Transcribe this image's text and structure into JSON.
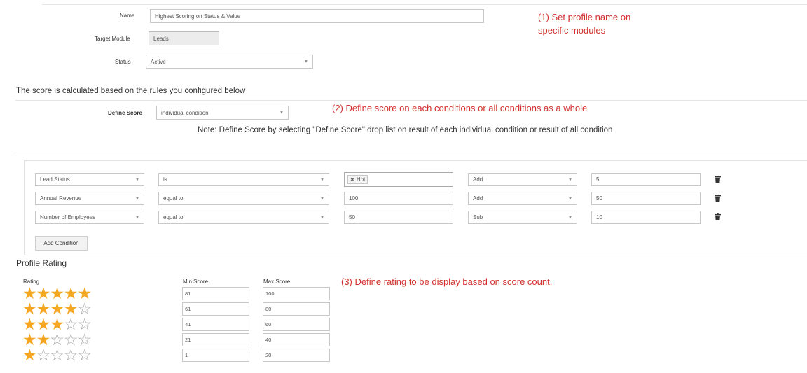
{
  "profile": {
    "name_label": "Name",
    "name_value": "Highest Scoring on Status & Value",
    "module_label": "Target Module",
    "module_value": "Leads",
    "status_label": "Status",
    "status_value": "Active"
  },
  "annotations": {
    "one_line1": "(1) Set profile name  on",
    "one_line2": "specific modules",
    "two": "(2) Define score on each conditions or all conditions as a whole",
    "three": "(3) Define rating to be display based on score count."
  },
  "score_section": {
    "heading": "The score is calculated based on the rules you configured below",
    "define_label": "Define Score",
    "define_value": "individual condition",
    "note": "Note: Define Score by selecting \"Define Score\" drop list on result of each individual condition or result of all condition"
  },
  "conditions": [
    {
      "field": "Lead Status",
      "operator": "is",
      "value": "Hot",
      "action": "Add",
      "points": "5"
    },
    {
      "field": "Annual Revenue",
      "operator": "equal to",
      "value": "100",
      "action": "Add",
      "points": "50"
    },
    {
      "field": "Number of Employees",
      "operator": "equal to",
      "value": "50",
      "action": "Sub",
      "points": "10"
    }
  ],
  "add_condition_label": "Add Condition",
  "rating": {
    "heading": "Profile Rating",
    "col_rating": "Rating",
    "col_min": "Min Score",
    "col_max": "Max Score",
    "rows": [
      {
        "stars": 5,
        "min": "81",
        "max": "100"
      },
      {
        "stars": 4,
        "min": "61",
        "max": "80"
      },
      {
        "stars": 3,
        "min": "41",
        "max": "60"
      },
      {
        "stars": 2,
        "min": "21",
        "max": "40"
      },
      {
        "stars": 1,
        "min": "1",
        "max": "20"
      }
    ]
  },
  "colors": {
    "annotation": "#d32f2f",
    "star_on": "#f5a623",
    "star_off": "#a8a8a8"
  }
}
